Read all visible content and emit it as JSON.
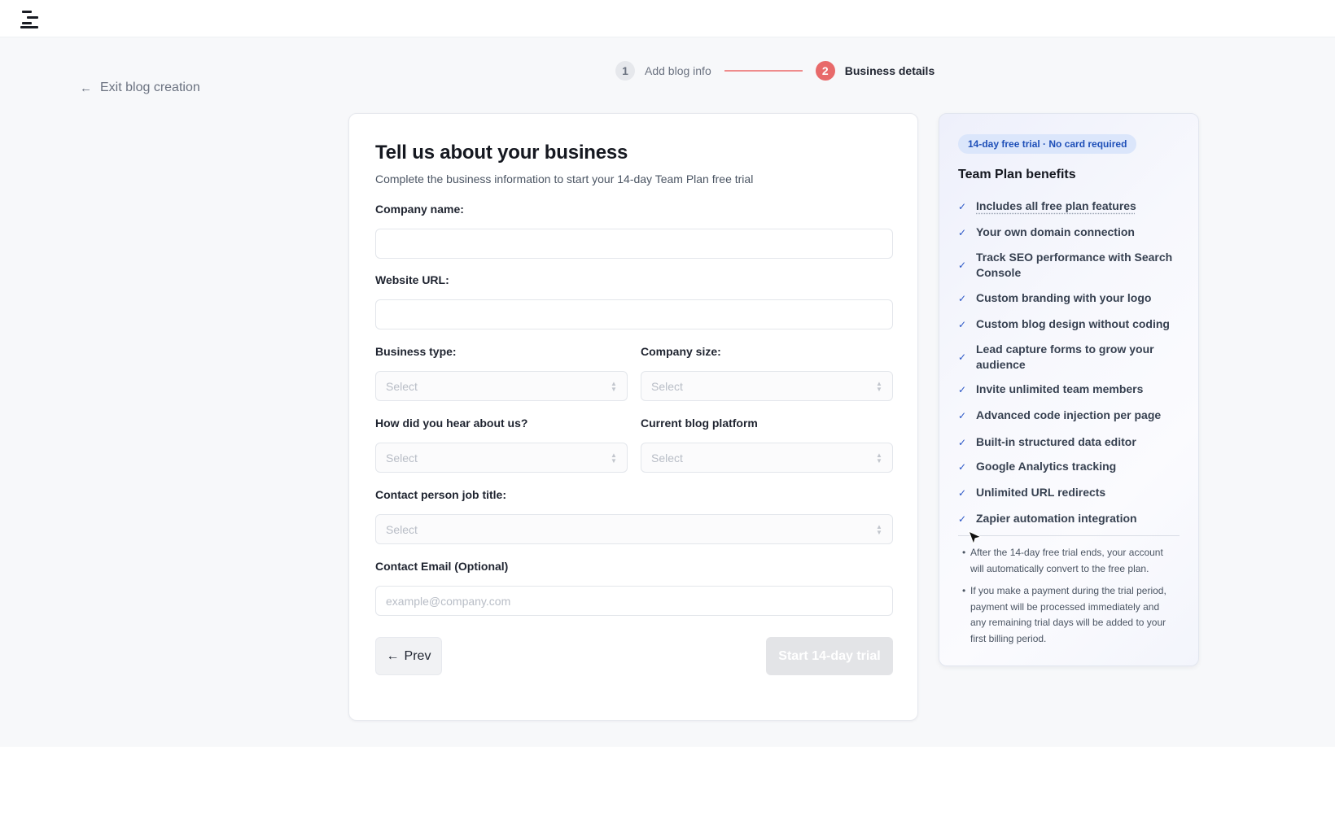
{
  "header": {
    "logo_icon": "stacked-bars-logo-icon"
  },
  "stepper": {
    "steps": [
      {
        "number": "1",
        "label": "Add blog info",
        "state": "done"
      },
      {
        "number": "2",
        "label": "Business details",
        "state": "active"
      }
    ],
    "active_color": "#e86a6a"
  },
  "exit": {
    "label": "Exit blog creation",
    "icon": "arrow-left-icon"
  },
  "form": {
    "title": "Tell us about your business",
    "subtitle": "Complete the business information to start your 14-day Team Plan free trial",
    "company_name": {
      "label": "Company name:",
      "value": ""
    },
    "website_url": {
      "label": "Website URL:",
      "value": ""
    },
    "business_type": {
      "label": "Business type:",
      "value": "Select"
    },
    "company_size": {
      "label": "Company size:",
      "value": "Select"
    },
    "heard_about": {
      "label": "How did you hear about us?",
      "value": "Select"
    },
    "blog_platform": {
      "label": "Current blog platform",
      "value": "Select"
    },
    "job_title": {
      "label": "Contact person job title:",
      "value": "Select"
    },
    "contact_email": {
      "label": "Contact Email (Optional)",
      "placeholder": "example@company.com",
      "value": ""
    },
    "prev_button": "Prev",
    "start_button": "Start 14-day trial"
  },
  "panel": {
    "badge": "14-day free trial · No card required",
    "title": "Team Plan benefits",
    "benefits": [
      "Includes all free plan features",
      "Your own domain connection",
      "Track SEO performance with Search Console",
      "Custom branding with your logo",
      "Custom blog design without coding",
      "Lead capture forms to grow your audience",
      "Invite unlimited team members",
      "Advanced code injection per page",
      "Built-in structured data editor",
      "Google Analytics tracking",
      "Unlimited URL redirects",
      "Zapier automation integration"
    ],
    "notes": [
      "After the 14-day free trial ends, your account will automatically convert to the free plan.",
      "If you make a payment during the trial period, payment will be processed immediately and any remaining trial days will be added to your first billing period."
    ],
    "accent": "#2a56c6"
  }
}
